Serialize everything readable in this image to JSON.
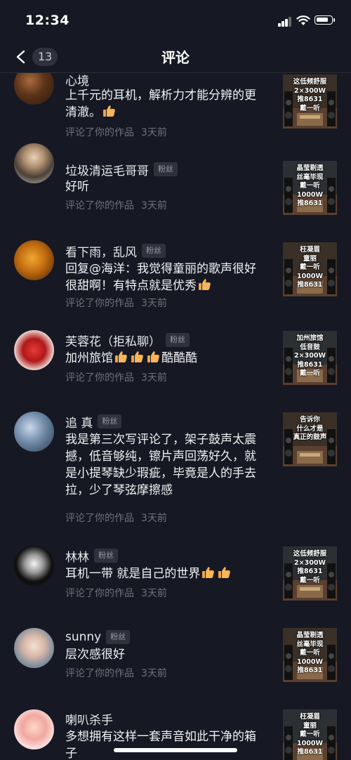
{
  "status_bar": {
    "time": "12:34"
  },
  "nav": {
    "back_count": "13",
    "title": "评论"
  },
  "comments": [
    {
      "name": "心境",
      "fan_tag": "",
      "text": "上千元的耳机，解析力才能分辨的更清澈。",
      "likes": 1,
      "meta_action": "评论了你的作品",
      "meta_time": "3天前",
      "thumb_lines": [
        "这低频舒服",
        "2×300W",
        "推8631",
        "戴一听"
      ]
    },
    {
      "name": "垃圾清运毛哥哥",
      "fan_tag": "粉丝",
      "text": "好听",
      "likes": 0,
      "meta_action": "评论了你的作品",
      "meta_time": "3天前",
      "thumb_lines": [
        "晶莹剔透",
        "丝毫毕现",
        "戴一听",
        "1000W",
        "推8631"
      ]
    },
    {
      "name": "看下雨，乱风",
      "fan_tag": "粉丝",
      "text": "回复@海洋：我觉得童丽的歌声很好很甜啊！有特点就是优秀",
      "likes": 1,
      "meta_action": "评论了你的作品",
      "meta_time": "3天前",
      "thumb_lines": [
        "枉凝眉",
        "童丽",
        "戴一听",
        "1000W",
        "推8631"
      ]
    },
    {
      "name": "芙蓉花（拒私聊）",
      "fan_tag": "粉丝",
      "text": "加州旅馆",
      "likes": 3,
      "text_after": "酷酷酷",
      "meta_action": "评论了你的作品",
      "meta_time": "3天前",
      "thumb_lines": [
        "加州旅馆",
        "低音鼓",
        "2×300W",
        "推8631",
        "戴一听"
      ]
    },
    {
      "name": "追 真",
      "fan_tag": "粉丝",
      "text": "我是第三次写评论了，架子鼓声太震撼，低音够纯，镲片声回荡好久，就是小提琴缺少瑕疵，毕竟是人的手去拉，少了琴弦摩擦感",
      "likes": 0,
      "meta_action": "评论了你的作品",
      "meta_time": "3天前",
      "thumb_lines": [
        "告诉你",
        "什么才是",
        "真正的鼓声"
      ]
    },
    {
      "name": "林林",
      "fan_tag": "粉丝",
      "text": "耳机一带 就是自己的世界",
      "likes": 2,
      "meta_action": "评论了你的作品",
      "meta_time": "3天前",
      "thumb_lines": [
        "这低频舒服",
        "2×300W",
        "推8631",
        "戴一听"
      ]
    },
    {
      "name": "sunny",
      "fan_tag": "粉丝",
      "text": "层次感很好",
      "likes": 0,
      "meta_action": "评论了你的作品",
      "meta_time": "3天前",
      "thumb_lines": [
        "晶莹剔透",
        "丝毫毕现",
        "戴一听",
        "1000W",
        "推8631"
      ]
    },
    {
      "name": "喇叭杀手",
      "fan_tag": "",
      "text": "多想拥有这样一套声音如此干净的箱子",
      "likes": 0,
      "meta_action": "",
      "meta_time": "",
      "thumb_lines": [
        "枉凝眉",
        "童丽",
        "戴一听",
        "1000W",
        "推8631"
      ]
    }
  ]
}
